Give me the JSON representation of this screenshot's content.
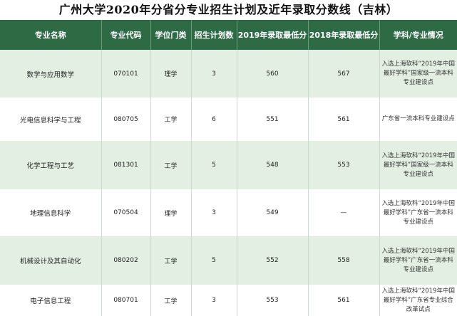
{
  "title": "广州大学2020年分省分专业招生计划及近年录取分数线（吉林）",
  "headers": [
    "专业名称",
    "专业代码",
    "学位门类",
    "招生计划数",
    "2019年录取最低分",
    "2018年录取最低分",
    "学科/专业情况"
  ],
  "rows": [
    {
      "name": "数学与应用数学",
      "code": "070101",
      "degree": "理学",
      "plan": "3",
      "score2019": "560",
      "score2018": "567",
      "info": "入选上海软科“2019年中国最好学科”国家级一流本科专业建设点"
    },
    {
      "name": "光电信息科学与工程",
      "code": "080705",
      "degree": "工学",
      "plan": "6",
      "score2019": "551",
      "score2018": "561",
      "info": "广东省一流本科专业建设点"
    },
    {
      "name": "化学工程与工艺",
      "code": "081301",
      "degree": "工学",
      "plan": "5",
      "score2019": "548",
      "score2018": "553",
      "info": "入选上海软科“2019年中国最好学科”国家级一流本科专业建设点"
    },
    {
      "name": "地理信息科学",
      "code": "070504",
      "degree": "理学",
      "plan": "3",
      "score2019": "549",
      "score2018": "—",
      "info": "入选上海软科“2019年中国最好学科”广东省一流本科专业建设点"
    },
    {
      "name": "机械设计及其自动化",
      "code": "080202",
      "degree": "工学",
      "plan": "5",
      "score2019": "552",
      "score2018": "558",
      "info": "入选上海软科“2019年中国最好学科”广东省一流本科专业建设点"
    },
    {
      "name": "电子信息工程",
      "code": "080701",
      "degree": "工学",
      "plan": "3",
      "score2019": "553",
      "score2018": "561",
      "info": "入选上海软科“2019年中国最好学科”广东省专业综合改革试点"
    }
  ]
}
